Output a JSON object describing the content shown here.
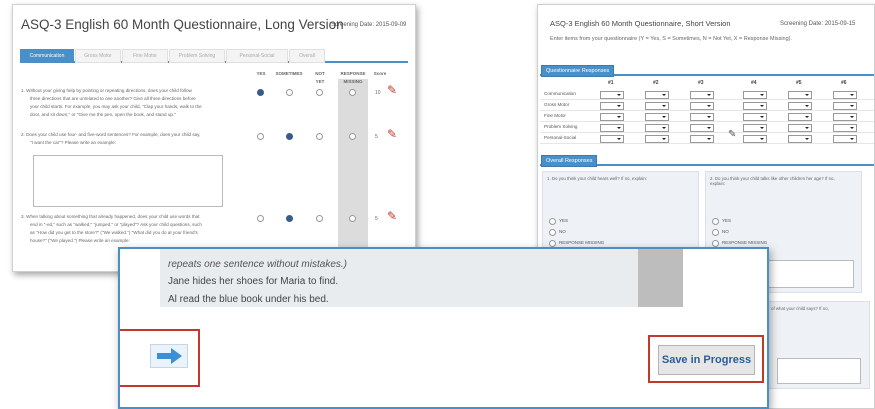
{
  "long_form": {
    "title": "ASQ-3 English 60 Month Questionnaire, Long Version",
    "screening_date": "Screening Date: 2015-09-09",
    "tabs": [
      "Communication",
      "Gross Motor",
      "Fine Motor",
      "Problem Solving",
      "Personal-Social",
      "Overall"
    ],
    "columns": {
      "yes": "YES",
      "sometimes": "SOMETIMES",
      "not_yet_1": "NOT",
      "not_yet_2": "YET",
      "response_1": "RESPONSE",
      "response_2": "MISSING",
      "score": "Score"
    },
    "questions": [
      {
        "lines": [
          "1.  Without your giving help by pointing or repeating directions, does your child follow",
          "three directions that are unrelated to one another? Give all three directions before",
          "your child starts. For example, you may ask your child, \"Clap your hands, walk to the",
          "door, and sit down,\" or \"Give me the pen, open the book, and stand up.\""
        ],
        "score": "10",
        "selected": "yes"
      },
      {
        "lines": [
          "2.  Does your child use four- and five-word sentences? For example, does your child say,",
          "\"I want the car\"? Please write an example:"
        ],
        "score": "5",
        "selected": "sometimes"
      },
      {
        "lines": [
          "3.  When talking about something that already happened, does your child use words that",
          "end in \"-ed,\" such as \"walked,\" \"jumped,\" or \"played\"? Ask your child questions, such",
          "as \"How did you get to the store?\" (\"We walked.\") \"What did you do at your friend's",
          "house?\" (\"We played.\") Please write an example:"
        ],
        "score": "5",
        "selected": "sometimes"
      }
    ]
  },
  "short_form": {
    "title": "ASQ-3 English 60 Month Questionnaire, Short Version",
    "screening_date": "Screening Date: 2015-09-15",
    "instructions": "Enter items from your questionnaire (Y = Yes, S = Sometimes, N = Not Yet, X = Response Missing).",
    "section_responses": "Questionnaire Responses",
    "col_nums": [
      "#1",
      "#2",
      "#3",
      "#4",
      "#5",
      "#6"
    ],
    "rows": [
      "Communication",
      "Gross Motor",
      "Fine Motor",
      "Problem Solving",
      "Personal-Social"
    ],
    "section_overall": "Overall Responses",
    "overall_q1": "1. Do you think your child hears well? If no, explain:",
    "overall_q2": "2. Do you think your child talks like other children her age? If no, explain:",
    "overall_q3": "of what your child says? If no,",
    "options": [
      "YES",
      "NO",
      "RESPONSE MISSING"
    ]
  },
  "overlay": {
    "italic_text": "repeats one sentence without mistakes.)",
    "sentences": [
      "Jane hides her shoes for Maria to find.",
      "Al read the blue book under his bed."
    ],
    "save_label": "Save in Progress"
  },
  "colors": {
    "accent": "#4a90c8",
    "highlight": "#c0392b"
  }
}
